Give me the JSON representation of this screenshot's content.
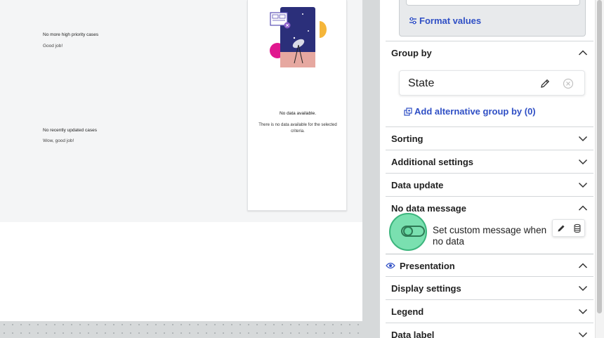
{
  "canvas": {
    "cards": [
      {
        "title": "No more high priority cases",
        "subtitle": "Good job!"
      },
      {
        "title": "No recently updated cases",
        "subtitle": "Wow, good job!"
      }
    ],
    "nodata_card": {
      "title": "No data available.",
      "subtitle": "There is no data available for the selected criteria."
    }
  },
  "panel": {
    "format_values_label": "Format values",
    "group_by": {
      "label": "Group by",
      "value": "State",
      "add_alternative_label": "Add alternative group by (0)"
    },
    "sections": {
      "sorting": "Sorting",
      "additional_settings": "Additional settings",
      "data_update": "Data update",
      "no_data_message": "No data message",
      "presentation": "Presentation",
      "display_settings": "Display settings",
      "legend": "Legend",
      "data_label": "Data label"
    },
    "custom_message_toggle_label": "Set custom message when no data",
    "custom_message_toggle_on": false
  },
  "colors": {
    "link": "#2f4fc5",
    "highlight": "#4ed696"
  },
  "icons": [
    "format-values-icon",
    "pencil-icon",
    "clear-icon",
    "add-group-icon",
    "chevron-up-icon",
    "chevron-down-icon",
    "eye-icon",
    "database-icon",
    "toggle"
  ]
}
